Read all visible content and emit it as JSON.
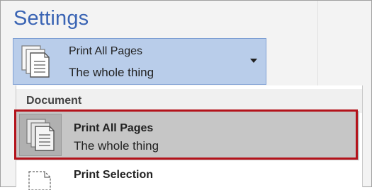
{
  "settings": {
    "title": "Settings",
    "selector": {
      "label": "Print All Pages",
      "subtitle": "The whole thing",
      "icon": "pages-stack-icon"
    },
    "dropdown": {
      "group_label": "Document",
      "items": [
        {
          "label": "Print All Pages",
          "subtitle": "The whole thing",
          "icon": "pages-stack-icon",
          "selected": true
        },
        {
          "label": "Print Selection",
          "icon": "page-selection-icon"
        }
      ]
    }
  },
  "colors": {
    "accent_title": "#3a64b4",
    "selector_bg": "#b9cdea",
    "highlight_border": "#b3121a"
  }
}
